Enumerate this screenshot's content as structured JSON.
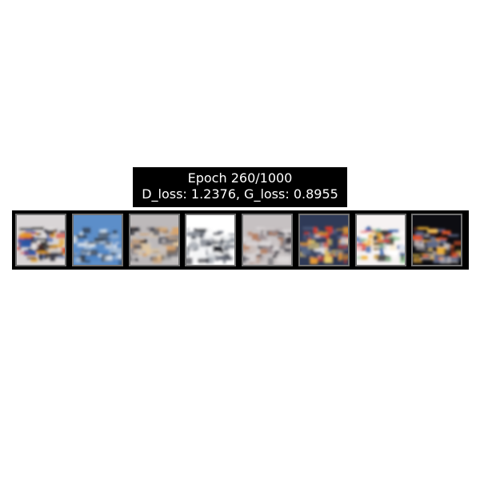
{
  "figure": {
    "title_line_1": "Epoch 260/1000",
    "title_line_2": "D_loss: 1.2376, G_loss: 0.8955"
  },
  "samples": [
    {
      "name": "generated-sample-1",
      "palette": [
        "#e8e4e2",
        "#3a3a46",
        "#e8a020",
        "#d63b2a",
        "#2a58a8",
        "#1a1a1a"
      ],
      "background": "#d9d5d6"
    },
    {
      "name": "generated-sample-2",
      "palette": [
        "#4f86c6",
        "#a9bfd8",
        "#e6ecf2",
        "#58616c",
        "#2d3744",
        "#c8d3df"
      ],
      "background": "#5c8ec9"
    },
    {
      "name": "generated-sample-3",
      "palette": [
        "#c8c4c3",
        "#e2c79e",
        "#8f8a8c",
        "#d6a36c",
        "#4b4d57",
        "#262833"
      ],
      "background": "#bdb9ba"
    },
    {
      "name": "generated-sample-4",
      "palette": [
        "#ffffff",
        "#2b2d35",
        "#636874",
        "#8d939c",
        "#121319",
        "#f3f4f6"
      ],
      "background": "#ffffff"
    },
    {
      "name": "generated-sample-5",
      "palette": [
        "#cdc7c7",
        "#5b5961",
        "#9c8f92",
        "#b57c5c",
        "#2e2c33",
        "#ddd9da"
      ],
      "background": "#c6c1c2"
    },
    {
      "name": "generated-sample-6",
      "palette": [
        "#2c3650",
        "#d63b2a",
        "#e89b34",
        "#e6e6ec",
        "#5c6c8f",
        "#f2d46b"
      ],
      "background": "#2f3a57"
    },
    {
      "name": "generated-sample-7",
      "palette": [
        "#ffffff",
        "#e23a3a",
        "#2e5fa8",
        "#f0b23a",
        "#3b3b3b",
        "#9ccfa0"
      ],
      "background": "#f6f2f2"
    },
    {
      "name": "generated-sample-8",
      "palette": [
        "#0b0b0f",
        "#f2b233",
        "#e2572a",
        "#c9c5c6",
        "#5e6a8a",
        "#ffd55a"
      ],
      "background": "#0d0d12"
    }
  ]
}
